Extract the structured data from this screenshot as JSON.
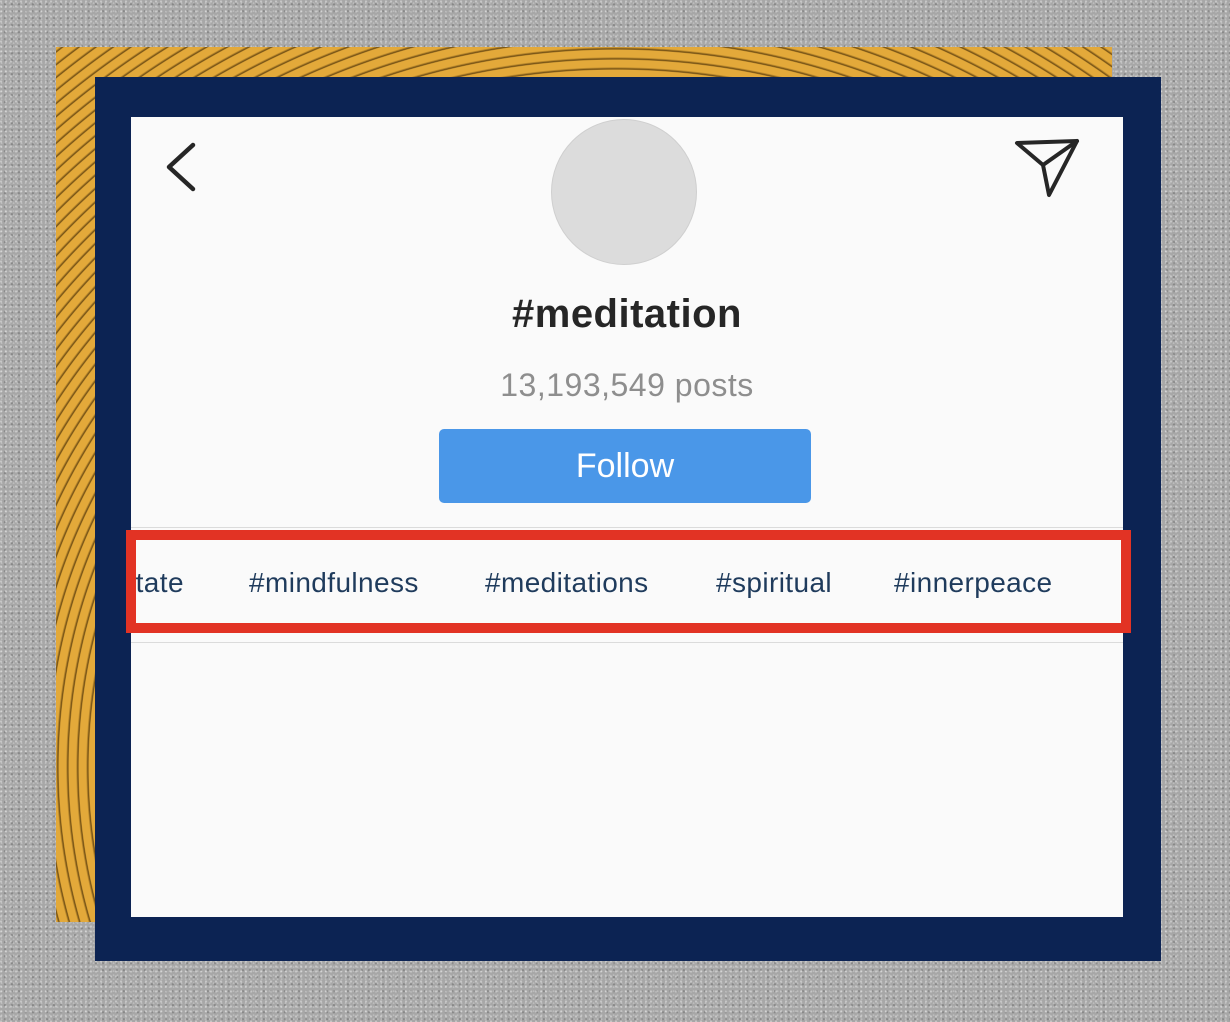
{
  "header": {
    "back_icon": "chevron-left-icon",
    "share_icon": "paper-plane-icon"
  },
  "profile": {
    "title": "#meditation",
    "post_count": "13,193,549 posts",
    "follow_label": "Follow"
  },
  "related_tags": [
    "itate",
    "#mindfulness",
    "#meditations",
    "#spiritual",
    "#innerpeace"
  ],
  "colors": {
    "follow_button": "#4a97e8",
    "highlight": "#e23324",
    "frame": "#0c2353",
    "backdrop_accent": "#e0a531"
  }
}
